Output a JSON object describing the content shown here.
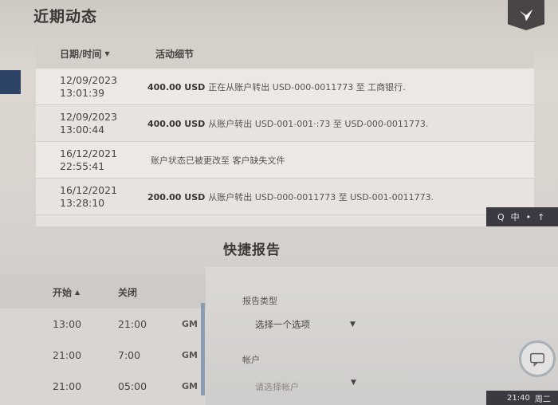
{
  "recent_activity": {
    "title": "近期动态",
    "columns": {
      "date": "日期/时间",
      "detail": "活动细节"
    },
    "rows": [
      {
        "date": "12/09/2023",
        "time": "13:01:39",
        "amount": "400.00 USD",
        "text": "正在从账户转出 USD-000-0011773 至 工商银行."
      },
      {
        "date": "12/09/2023",
        "time": "13:00:44",
        "amount": "400.00 USD",
        "text": "从账户转出 USD-001-001·:73 至 USD-000-0011773."
      },
      {
        "date": "16/12/2021",
        "time": "22:55:41",
        "amount": "",
        "text": "账户状态已被更改至 客户缺失文件"
      },
      {
        "date": "16/12/2021",
        "time": "13:28:10",
        "amount": "200.00 USD",
        "text": "从账户转出 USD-000-0011773 至 USD-001-0011773."
      }
    ]
  },
  "taskbar": {
    "search": "Q",
    "lang": "中",
    "mode": "•",
    "extra": "↑"
  },
  "quick_report": {
    "title": "快捷报告",
    "report_type_label": "报告类型",
    "report_type_value": "选择一个选项",
    "account_label": "帐户",
    "account_placeholder": "请选择帐户"
  },
  "trading_hours": {
    "columns": {
      "open": "开始",
      "close": "关闭"
    },
    "rows": [
      {
        "open": "13:00",
        "close": "21:00",
        "tz": "GM"
      },
      {
        "open": "21:00",
        "close": "7:00",
        "tz": "GM"
      },
      {
        "open": "21:00",
        "close": "05:00",
        "tz": "GM"
      }
    ]
  },
  "clock": {
    "time": "21:40",
    "day": "周二"
  }
}
